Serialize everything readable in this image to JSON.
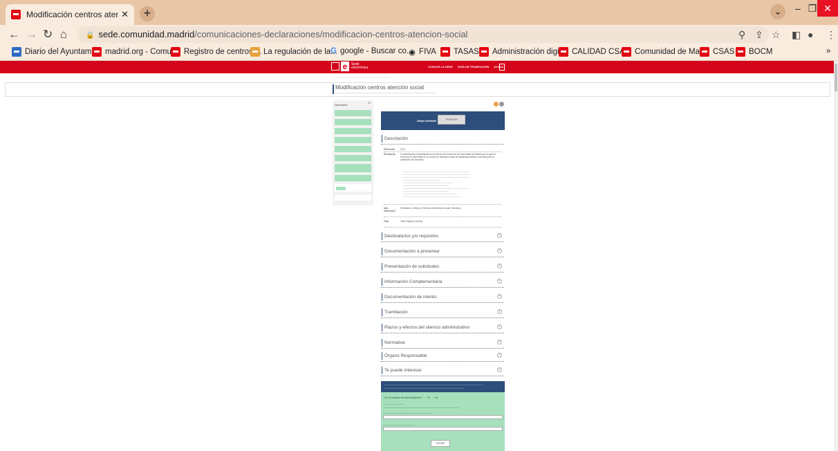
{
  "browser": {
    "tab_title": "Modificación centros atención so",
    "tab_close": "✕",
    "new_tab": "+",
    "window_controls": {
      "dropdown": "⌄",
      "minimize": "–",
      "restore": "❐",
      "close": "✕"
    },
    "url_host": "sede.comunidad.madrid",
    "url_path": "/comunicaciones-declaraciones/modificacion-centros-atencion-social",
    "bookmarks": [
      "Diario del Ayuntami...",
      "madrid.org - Comu...",
      "Registro de centros,...",
      "La regulación de la...",
      "google - Buscar co...",
      "FIVA",
      "TASAS",
      "Administración digi...",
      "CALIDAD CSAS",
      "Comunidad de Ma...",
      "CSAS",
      "BOCM"
    ],
    "bookmarks_more": "»"
  },
  "site": {
    "logo_text": "Sede electrónica",
    "top_links": [
      "CONOCE LA SEDE",
      "GUÍA DE TRAMITACIÓN",
      "AYUDA"
    ],
    "page_title": "Modificación centros atención social"
  },
  "sidebar": {
    "title": "Secciones"
  },
  "banner": {
    "title": "Altaya Indefinido",
    "button": "TRAMITAR"
  },
  "description": {
    "heading": "Descripción",
    "rows": [
      {
        "key": "Referencia",
        "value": "1141"
      },
      {
        "key": "Descripción",
        "value": "La autorización administrativa es la forma de control de la Comunidad de Madrid por la que se reconoce la idoneidad de un centro de atención social de titularidad pública o privada para la prestación de servicios."
      },
      {
        "key": "Más información",
        "value": "Entidades, Centros y Servicios de atención social: Servicios"
      },
      {
        "key": "Tasa",
        "value": "Tasa exigida y exenta"
      }
    ]
  },
  "sections": [
    "Destinatarios y/o requisitos",
    "Documentación a presentar",
    "Presentación de solicitudes",
    "Información Complementaria",
    "Documentación de interés",
    "Tramitación",
    "Plazos y efectos del silencio administrativo",
    "Normativa",
    "Órgano Responsable",
    "Te puede interesar"
  ],
  "survey": {
    "question": "¿Te ha resultado útil esta información?*",
    "yes": "Sí",
    "no": "No",
    "send": "ENVIAR"
  }
}
